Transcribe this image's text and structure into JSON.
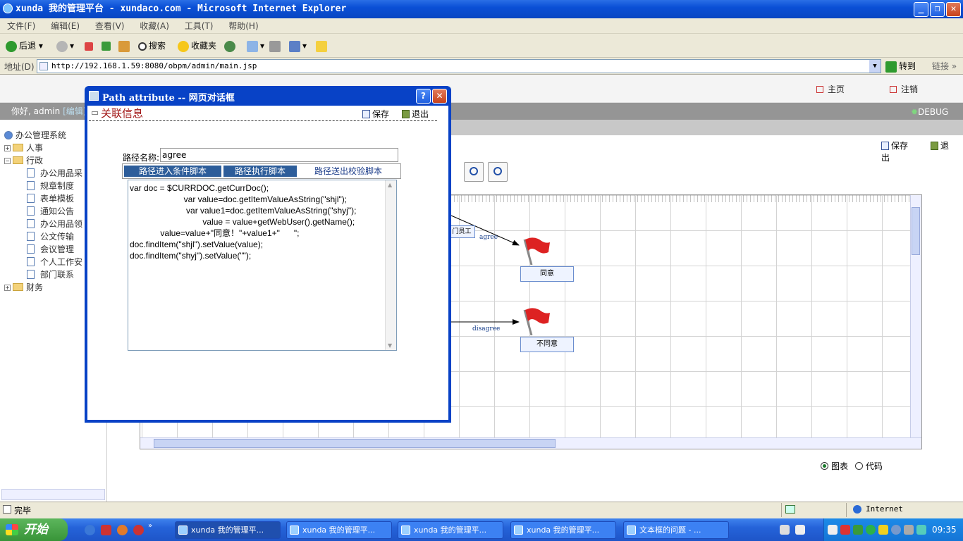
{
  "window": {
    "title": "xunda 我的管理平台 - xundaco.com - Microsoft Internet Explorer"
  },
  "menu": [
    "文件(F)",
    "编辑(E)",
    "查看(V)",
    "收藏(A)",
    "工具(T)",
    "帮助(H)"
  ],
  "toolbar": {
    "back": "后退",
    "search": "搜索",
    "favorites": "收藏夹"
  },
  "address": {
    "label": "地址(D)",
    "url": "http://192.168.1.59:8080/obpm/admin/main.jsp",
    "go": "转到",
    "links": "链接"
  },
  "header": {
    "home": "主页",
    "logout": "注销",
    "greeting": "你好, admin",
    "edit": "[编辑]",
    "debug": "DEBUG"
  },
  "sidebar": {
    "root": "办公管理系统",
    "groups": [
      {
        "label": "人事"
      },
      {
        "label": "行政"
      },
      {
        "label": "财务"
      }
    ],
    "items": [
      "办公用品采",
      "规章制度",
      "表单模板",
      "通知公告",
      "办公用品领",
      "公文传输",
      "会议管理",
      "个人工作安",
      "部门联系"
    ]
  },
  "main": {
    "save": "保存",
    "exit": "退出",
    "view_chart": "图表",
    "view_code": "代码",
    "view_selected": "图表"
  },
  "diagram": {
    "nodes": {
      "agree_node": "同意",
      "disagree_node": "不同意",
      "partial_node": "门员工"
    },
    "edges": {
      "agree": "agree",
      "disagree": "disagree"
    }
  },
  "dialog": {
    "title": "Path attribute -- 网页对话框",
    "heading": "关联信息",
    "save": "保存",
    "exit": "退出",
    "path_name_label": "路径名称:",
    "path_name_value": "agree",
    "tabs": [
      "路径进入条件脚本",
      "路径执行脚本",
      "路径送出校验脚本"
    ],
    "script": "var doc = $CURRDOC.getCurrDoc();\n                       var value=doc.getItemValueAsString(\"shjl\");\n                        var value1=doc.getItemValueAsString(\"shyj\");\n                               value = value+getWebUser().getName();\n             value=value+\"同意！\"+value1+\"      \";\ndoc.findItem(\"shjl\").setValue(value);\ndoc.findItem(\"shyj\").setValue(\"\");"
  },
  "status": {
    "text": "完毕",
    "zone": "Internet"
  },
  "taskbar": {
    "start": "开始",
    "tasks": [
      "xunda 我的管理平...",
      "xunda 我的管理平...",
      "xunda 我的管理平...",
      "xunda 我的管理平...",
      "文本框的问题 - ..."
    ],
    "clock": "09:35"
  }
}
